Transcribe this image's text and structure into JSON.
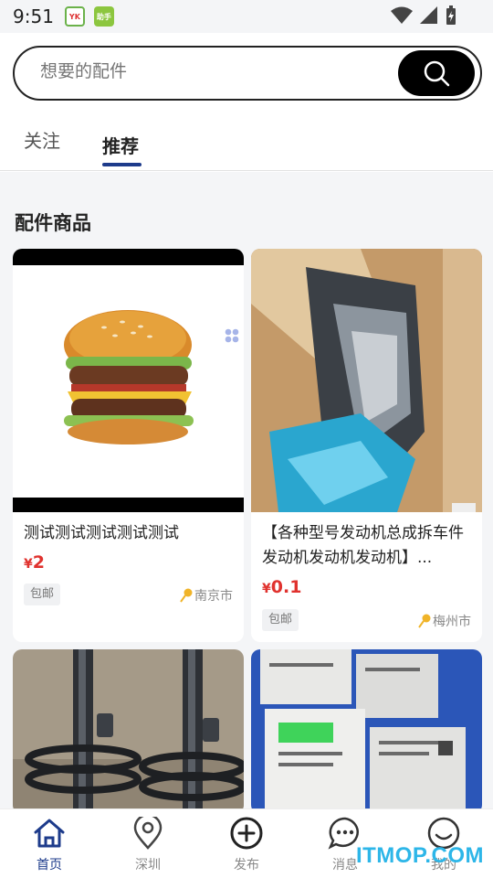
{
  "status_bar": {
    "time": "9:51",
    "app_icon_1": "YK",
    "app_icon_2": "助手"
  },
  "search": {
    "placeholder": "想要的配件",
    "button_icon": "search-icon"
  },
  "tabs": [
    {
      "label": "关注"
    },
    {
      "label": "推荐",
      "active": true
    }
  ],
  "section_title": "配件商品",
  "products": [
    {
      "title": "测试测试测试测试测试",
      "price_symbol": "¥",
      "price": "2",
      "tag": "包邮",
      "location": "南京市",
      "image": "burger"
    },
    {
      "title": "【各种型号发动机总成拆车件 发动机发动机发动机】...",
      "price_symbol": "¥",
      "price": "0.1",
      "tag": "包邮",
      "location": "梅州市",
      "image": "car-headlight"
    },
    {
      "image": "shock-absorbers"
    },
    {
      "image": "parts-boxes"
    }
  ],
  "tabbar": [
    {
      "label": "首页",
      "icon": "home-icon",
      "active": true
    },
    {
      "label": "深圳",
      "icon": "location-pin-icon"
    },
    {
      "label": "发布",
      "icon": "plus-circle-icon"
    },
    {
      "label": "消息",
      "icon": "chat-icon"
    },
    {
      "label": "我的",
      "icon": "smile-icon"
    }
  ],
  "watermark": "ITMOP.COM",
  "colors": {
    "accent": "#1d3b8b",
    "price": "#e0322e",
    "watermark": "#2db6e8"
  }
}
